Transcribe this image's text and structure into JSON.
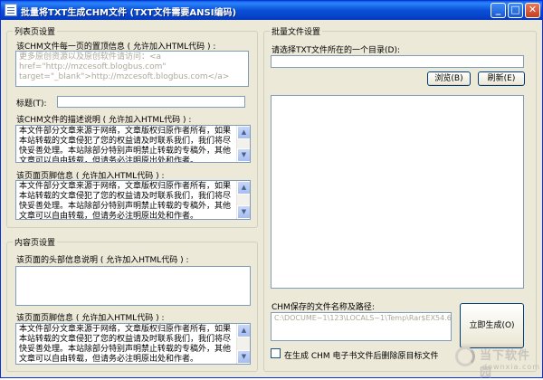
{
  "window": {
    "title": "批量将TXT生成CHM文件 (TXT文件需要ANSI编码)",
    "minimize_glyph": "_",
    "maximize_glyph": "□",
    "close_glyph": "✕"
  },
  "list_page": {
    "group_title": "列表页设置",
    "top_info_label": "该CHM文件每一页的置顶信息 ( 允许加入HTML代码 ) :",
    "top_info_value": "更多原创资源以及原创软件请访问：<a href=\"http://mzcesoft.blogbus.com\" target=\"_blank\">http://mzcesoft.blogbus.com</a>",
    "title_label": "标题(T):",
    "title_value": "",
    "desc_label": "该CHM文件的描述说明 ( 允许加入HTML代码 ) :",
    "desc_value": "本文件部分文章来源于网络，文章版权归原作者所有，如果本站转载的文章侵犯了您的权益请及时联系我们，我们将尽快妥善处理。本站除部分特别声明禁止转载的专稿外，其他文章可以自由转载，但请务必注明原出处和作者。",
    "footer_label": "该页面页脚信息 ( 允许加入HTML代码 ) :",
    "footer_value": "本文件部分文章来源于网络，文章版权归原作者所有，如果本站转载的文章侵犯了您的权益请及时联系我们，我们将尽快妥善处理。本站除部分特别声明禁止转载的专稿外，其他文章可以自由转载，但请务必注明原出处和作者。"
  },
  "content_page": {
    "group_title": "内容页设置",
    "header_label": "该页面的头部信息说明 ( 允许加入HTML代码 ) :",
    "header_value": "",
    "footer_label": "该页面页脚信息 ( 允许加入HTML代码 ) :",
    "footer_value": "本文件部分文章来源于网络，文章版权归原作者所有，如果本站转载的文章侵犯了您的权益请及时联系我们，我们将尽快妥善处理。本站除部分特别声明禁止转载的专稿外，其他文章可以自由转载，但请务必注明原出处和作者。"
  },
  "batch": {
    "group_title": "批量文件设置",
    "dir_label": "请选择TXT文件所在的一个目录(D):",
    "dir_value": "",
    "browse_button": "浏览(B)",
    "refresh_button": "刷新(E)",
    "save_label": "CHM保存的文件名称及路径:",
    "save_path_value": "C:\\DOCUME~1\\123\\LOCALS~1\\Temp\\Rar$EX54.688\\TxtChmFile\\Release\\test.chm",
    "generate_button": "立即生成(O)",
    "delete_checkbox_label": "在生成 CHM 电子书文件后删除原目标文件"
  },
  "watermark": {
    "brand": "当下软件园",
    "domain": "downxia.com"
  }
}
